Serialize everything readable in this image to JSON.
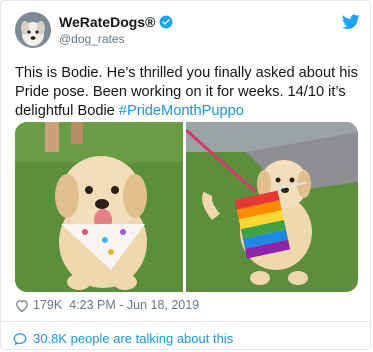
{
  "user": {
    "display_name": "WeRateDogs®",
    "handle": "@dog_rates",
    "avatar_icon": "dog-avatar",
    "verified_icon": "verified-badge-icon"
  },
  "tweet": {
    "text": "This is Bodie. He’s thrilled you finally asked about his Pride pose. Been working on it for weeks. 14/10 it’s delightful Bodie ",
    "hashtag": "#PrideMonthPuppo"
  },
  "stats": {
    "likes": "179K",
    "separator": "·",
    "timestamp": "4:23 PM - Jun 18, 2019"
  },
  "footer": {
    "talking": "30.8K people are talking about this"
  },
  "colors": {
    "link": "#1b95e0",
    "muted": "#657786",
    "border": "#e1e8ed"
  }
}
